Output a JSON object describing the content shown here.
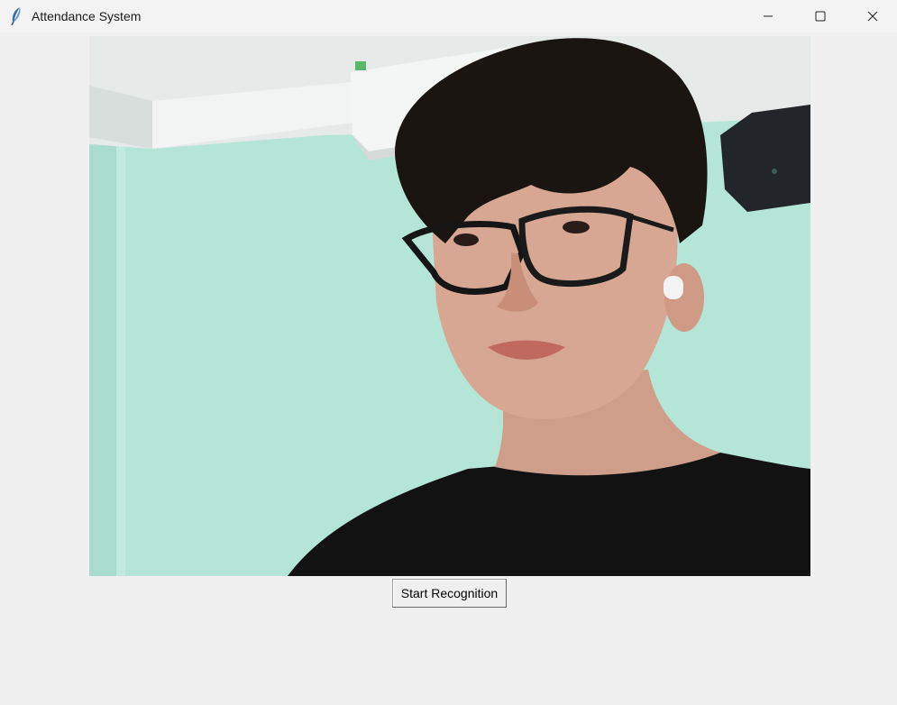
{
  "window": {
    "title": "Attendance System",
    "icon": "feather-icon",
    "controls": [
      "minimize-icon",
      "maximize-icon",
      "close-icon"
    ]
  },
  "camera_feed": {
    "content": "live webcam frame"
  },
  "actions": {
    "start_label": "Start Recognition"
  },
  "colors": {
    "window_background": "#f0f0f0",
    "wall": "#b5e6d8",
    "ceiling": "#e9ecea",
    "shirt": "#111111",
    "hair": "#1b1512"
  }
}
